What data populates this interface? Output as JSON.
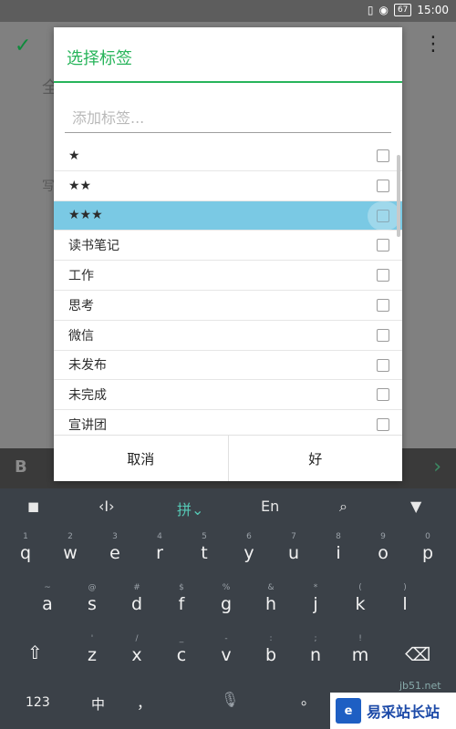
{
  "status_bar": {
    "battery": "67",
    "time": "15:00",
    "icons": [
      "vibrate-icon",
      "eye-icon",
      "battery-icon"
    ]
  },
  "background_app": {
    "title_char": "全",
    "line2_char": "写"
  },
  "dialog": {
    "title": "选择标签",
    "input_placeholder": "添加标签...",
    "tags": [
      {
        "label": "★",
        "selected": false
      },
      {
        "label": "★★",
        "selected": false
      },
      {
        "label": "★★★",
        "selected": true
      },
      {
        "label": "读书笔记",
        "selected": false
      },
      {
        "label": "工作",
        "selected": false
      },
      {
        "label": "思考",
        "selected": false
      },
      {
        "label": "微信",
        "selected": false
      },
      {
        "label": "未发布",
        "selected": false
      },
      {
        "label": "未完成",
        "selected": false
      },
      {
        "label": "宣讲团",
        "selected": false
      }
    ],
    "cancel_label": "取消",
    "ok_label": "好"
  },
  "keyboard": {
    "toolbar": {
      "pinyin": "拼",
      "english": "En"
    },
    "row1": [
      {
        "hint": "1",
        "key": "q"
      },
      {
        "hint": "2",
        "key": "w"
      },
      {
        "hint": "3",
        "key": "e"
      },
      {
        "hint": "4",
        "key": "r"
      },
      {
        "hint": "5",
        "key": "t"
      },
      {
        "hint": "6",
        "key": "y"
      },
      {
        "hint": "7",
        "key": "u"
      },
      {
        "hint": "8",
        "key": "i"
      },
      {
        "hint": "9",
        "key": "o"
      },
      {
        "hint": "0",
        "key": "p"
      }
    ],
    "row2": [
      {
        "hint": "~",
        "key": "a"
      },
      {
        "hint": "@",
        "key": "s"
      },
      {
        "hint": "#",
        "key": "d"
      },
      {
        "hint": "$",
        "key": "f"
      },
      {
        "hint": "%",
        "key": "g"
      },
      {
        "hint": "&",
        "key": "h"
      },
      {
        "hint": "*",
        "key": "j"
      },
      {
        "hint": "(",
        "key": "k"
      },
      {
        "hint": ")",
        "key": "l"
      }
    ],
    "row3": [
      {
        "hint": "'",
        "key": "z"
      },
      {
        "hint": "/",
        "key": "x"
      },
      {
        "hint": "_",
        "key": "c"
      },
      {
        "hint": "-",
        "key": "v"
      },
      {
        "hint": ":",
        "key": "b"
      },
      {
        "hint": ";",
        "key": "n"
      },
      {
        "hint": "!",
        "key": "m"
      }
    ],
    "num_label": "123",
    "lang_label": "中",
    "comma_label": "，",
    "period_label": "。"
  },
  "watermark": {
    "logo_text": "易采站长站",
    "site": "jb51.net"
  }
}
